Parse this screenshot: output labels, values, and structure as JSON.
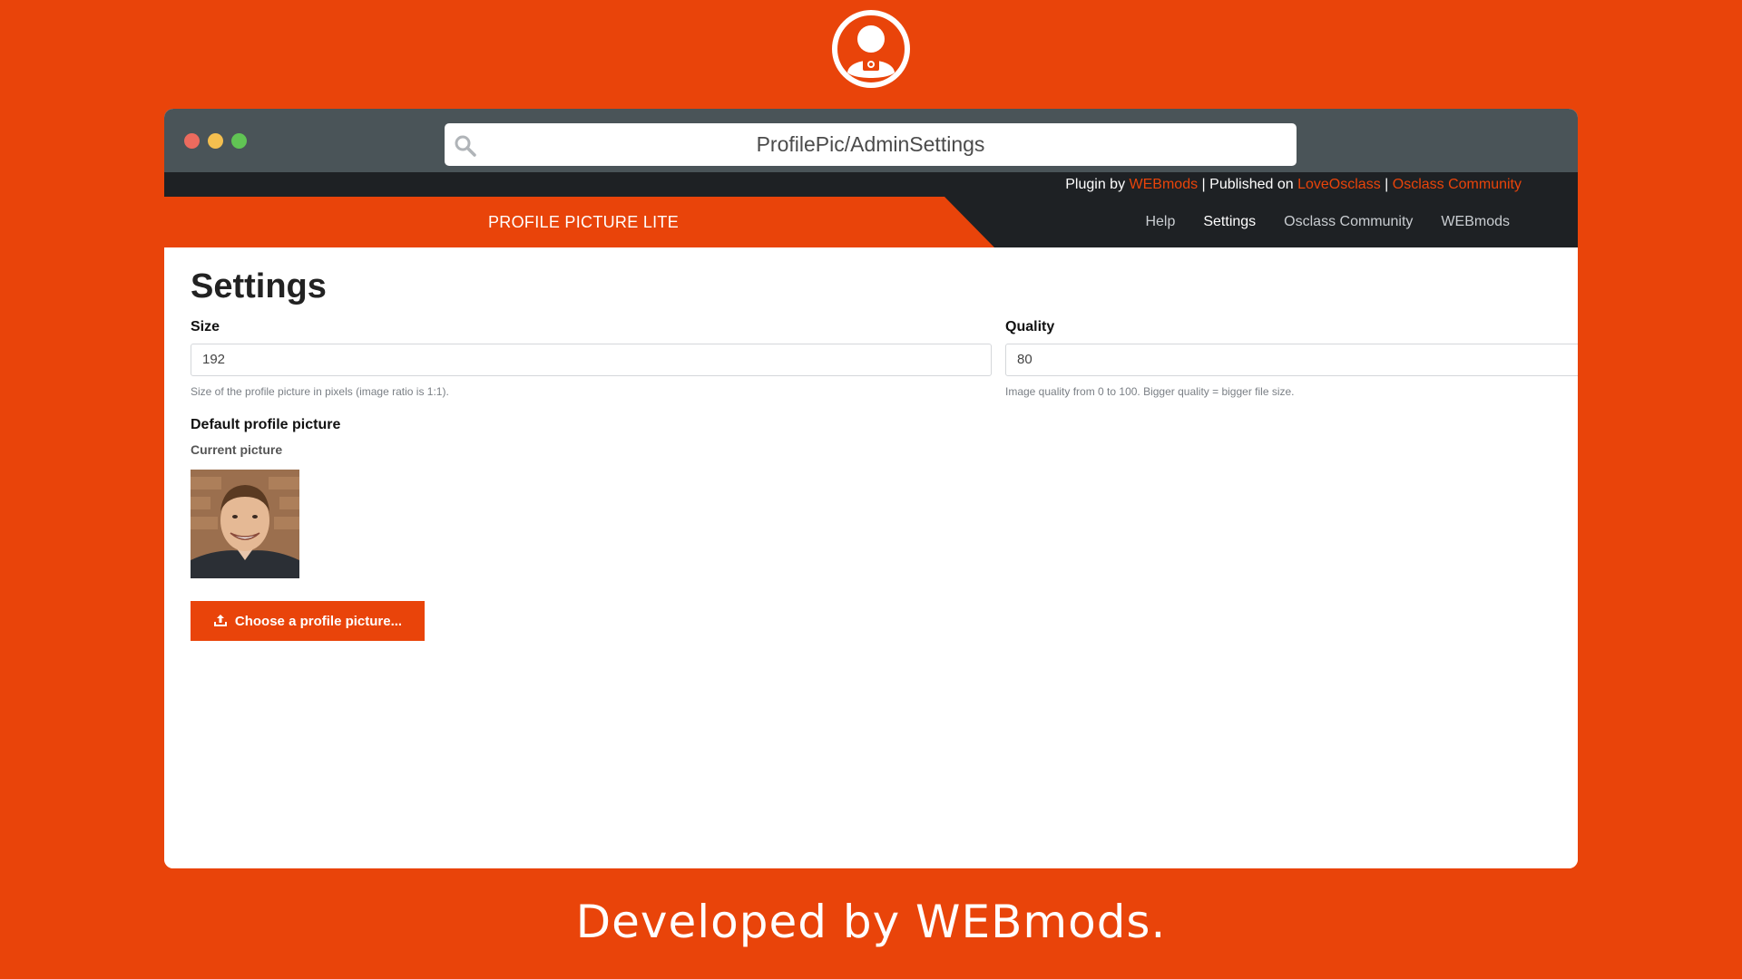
{
  "browser": {
    "url": "ProfilePic/AdminSettings"
  },
  "infobar": {
    "plugin_by": "Plugin by ",
    "plugin_author": "WEBmods",
    "separator1": " | Published on ",
    "published_on": "LoveOsclass",
    "separator2": " | ",
    "community": "Osclass Community"
  },
  "navbar": {
    "plugin_title": "PROFILE PICTURE LITE",
    "links": [
      "Help",
      "Settings",
      "Osclass Community",
      "WEBmods"
    ]
  },
  "settings": {
    "title": "Settings",
    "size_label": "Size",
    "size_value": "192",
    "size_help": "Size of the profile picture in pixels (image ratio is 1:1).",
    "quality_label": "Quality",
    "quality_value": "80",
    "quality_help": "Image quality from 0 to 100. Bigger quality = bigger file size.",
    "default_pic_label": "Default profile picture",
    "current_pic_label": "Current picture",
    "upload_button": "Choose a profile picture..."
  },
  "footer": {
    "text": "Developed by WEBmods."
  },
  "colors": {
    "accent": "#e9440a",
    "dark": "#1e2124",
    "chrome": "#4a5458"
  }
}
